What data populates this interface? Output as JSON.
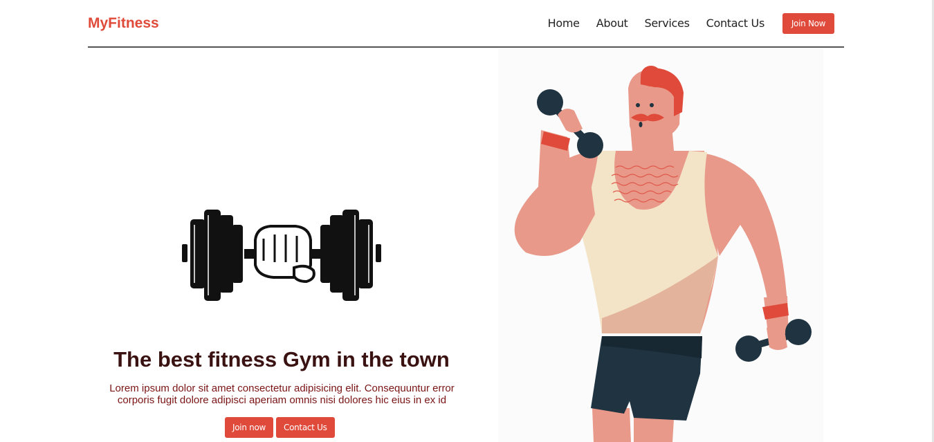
{
  "brand": {
    "name": "MyFitness"
  },
  "nav": {
    "links": [
      {
        "label": "Home"
      },
      {
        "label": "About"
      },
      {
        "label": "Services"
      },
      {
        "label": "Contact Us"
      }
    ],
    "cta_label": "Join Now"
  },
  "hero": {
    "headline": "The best fitness Gym in the town",
    "lead": "Lorem ipsum dolor sit amet consectetur adipisicing elit. Consequuntur error corporis fugit dolore adipisci aperiam omnis nisi dolores hic eius in ex id",
    "buttons": [
      {
        "label": "Join now"
      },
      {
        "label": "Contact Us"
      }
    ]
  },
  "icons": {
    "dumbbell": "dumbbell-fist-icon",
    "illustration": "bodybuilder-illustration"
  },
  "colors": {
    "accent": "#e04a3a",
    "headline": "#3b1212",
    "lead": "#7a1414",
    "dark": "#1f3340",
    "skin": "#e8998a",
    "tank": "#f3e4c7"
  }
}
